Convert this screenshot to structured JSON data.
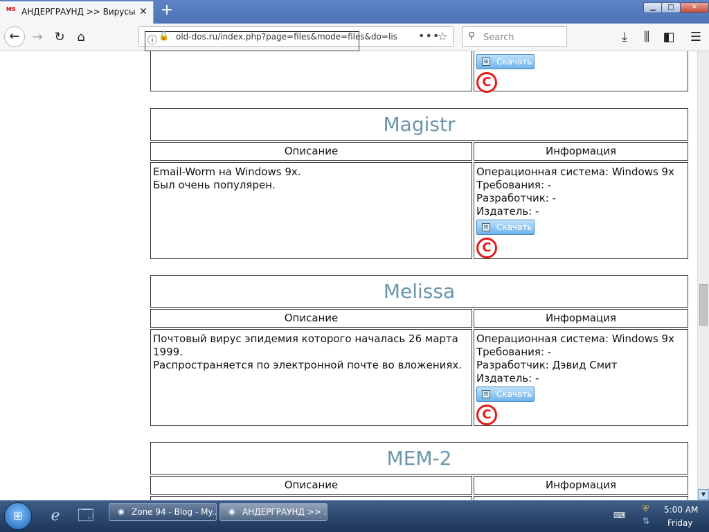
{
  "browser": {
    "tab_title": "АНДЕРГРАУНД >> Вирусы - Ста",
    "tab_favicon": "MS",
    "url": "old-dos.ru/index.php?page=files&mode=files&do=lis",
    "search_placeholder": "Search"
  },
  "labels": {
    "description_header": "Описание",
    "info_header": "Информация",
    "download_label": "Скачать",
    "copyright_symbol": "C"
  },
  "entries": [
    {
      "name": "Magistr",
      "description": [
        "Email-Worm на Windows 9x.",
        "Был очень популярен."
      ],
      "os": "Операционная система: Windows 9x",
      "requirements": "Требования: -",
      "developer": "Разработчик: -",
      "publisher": "Издатель: -"
    },
    {
      "name": "Melissa",
      "description": [
        "Почтовый вирус эпидемия которого началась 26 марта 1999.",
        "Распространяется по электронной почте во вложениях."
      ],
      "os": "Операционная система: Windows 9x",
      "requirements": "Требования: -",
      "developer": "Разработчик: Дэвид Смит",
      "publisher": "Издатель: -"
    },
    {
      "name": "MEM-2"
    }
  ],
  "taskbar": {
    "buttons": [
      {
        "label": "Zone 94 - Blog - My...",
        "icon": "browser-icon"
      },
      {
        "label": "АНДЕРГРАУНД >> ...",
        "icon": "browser-icon"
      }
    ],
    "time": "5:00 AM",
    "day": "Friday"
  }
}
